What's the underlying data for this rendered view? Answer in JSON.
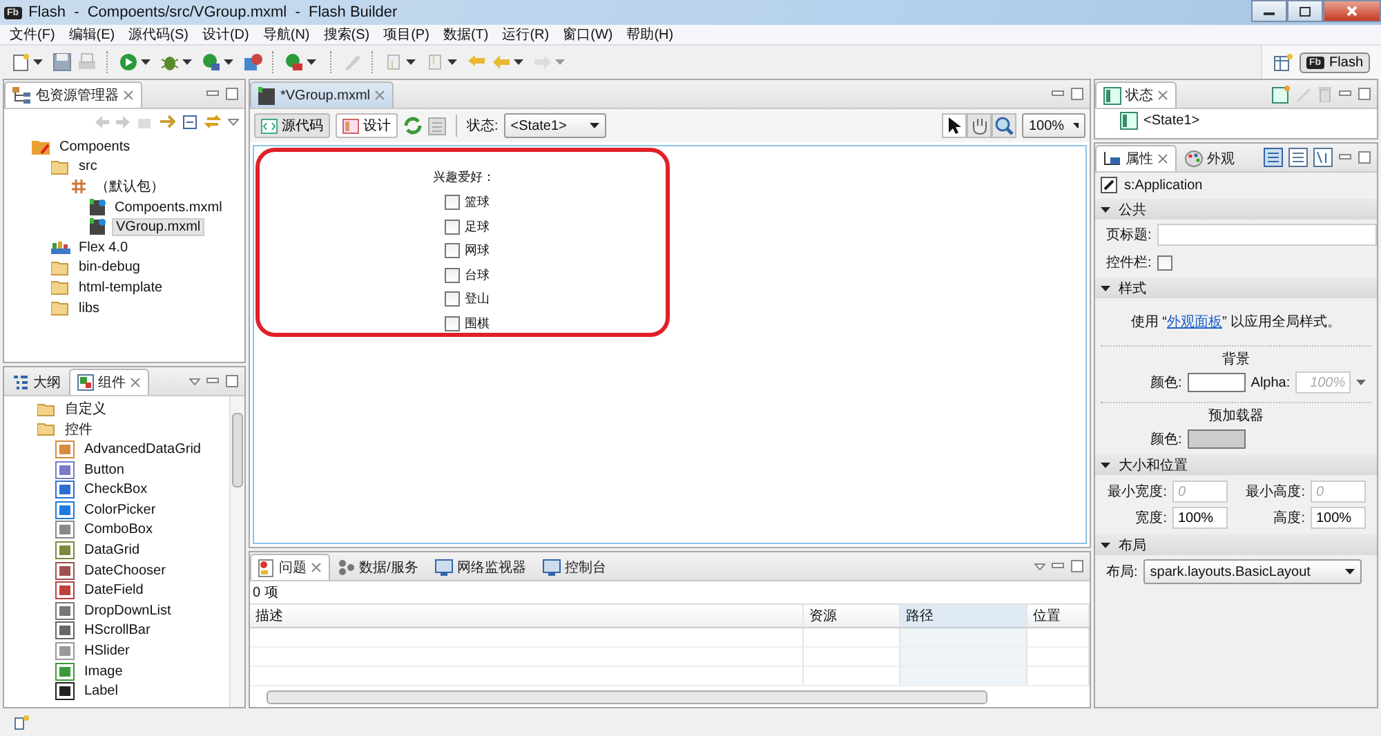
{
  "window": {
    "title": "Flash  -  Compoents/src/VGroup.mxml  -  Flash Builder",
    "badge": "Fb"
  },
  "menu": [
    "文件(F)",
    "编辑(E)",
    "源代码(S)",
    "设计(D)",
    "导航(N)",
    "搜索(S)",
    "项目(P)",
    "数据(T)",
    "运行(R)",
    "窗口(W)",
    "帮助(H)"
  ],
  "perspective": {
    "badge": "Fb",
    "label": "Flash"
  },
  "package_explorer": {
    "title": "包资源管理器",
    "tree": [
      {
        "label": "Compoents",
        "kind": "project",
        "selected": false,
        "children": [
          {
            "label": "src",
            "kind": "folder",
            "selected": false,
            "children": [
              {
                "label": "（默认包）",
                "kind": "package",
                "selected": false,
                "children": [
                  {
                    "label": "Compoents.mxml",
                    "kind": "file",
                    "selected": false
                  },
                  {
                    "label": "VGroup.mxml",
                    "kind": "file",
                    "selected": true
                  }
                ]
              }
            ]
          },
          {
            "label": "Flex 4.0",
            "kind": "library",
            "selected": false
          },
          {
            "label": "bin-debug",
            "kind": "folder",
            "selected": false
          },
          {
            "label": "html-template",
            "kind": "folder",
            "selected": false
          },
          {
            "label": "libs",
            "kind": "folder",
            "selected": false
          }
        ]
      }
    ]
  },
  "components_panel": {
    "tabs": [
      {
        "label": "大纲",
        "selected": false
      },
      {
        "label": "组件",
        "selected": true
      }
    ],
    "tree": [
      {
        "label": "自定义",
        "kind": "folder"
      },
      {
        "label": "控件",
        "kind": "folder",
        "children": [
          {
            "label": "AdvancedDataGrid"
          },
          {
            "label": "Button"
          },
          {
            "label": "CheckBox"
          },
          {
            "label": "ColorPicker"
          },
          {
            "label": "ComboBox"
          },
          {
            "label": "DataGrid"
          },
          {
            "label": "DateChooser"
          },
          {
            "label": "DateField"
          },
          {
            "label": "DropDownList"
          },
          {
            "label": "HScrollBar"
          },
          {
            "label": "HSlider"
          },
          {
            "label": "Image"
          },
          {
            "label": "Label"
          }
        ]
      }
    ]
  },
  "editor": {
    "tabs": [
      {
        "label": "*VGroup.mxml",
        "selected": true
      }
    ],
    "view_modes": [
      {
        "label": "源代码",
        "selected": false
      },
      {
        "label": "设计",
        "selected": true
      }
    ],
    "state_label": "状态:",
    "state_value": "<State1>",
    "tools": [
      {
        "kind": "pointer",
        "selected": true
      },
      {
        "kind": "hand",
        "selected": false
      },
      {
        "kind": "zoom",
        "selected": false
      }
    ],
    "zoom": "100%",
    "canvas": {
      "heading": "兴趣爱好：",
      "checkboxes": [
        {
          "label": "篮球",
          "checked": false
        },
        {
          "label": "足球",
          "checked": false
        },
        {
          "label": "网球",
          "checked": false
        },
        {
          "label": "台球",
          "checked": false
        },
        {
          "label": "登山",
          "checked": false
        },
        {
          "label": "围棋",
          "checked": false
        }
      ]
    }
  },
  "problems_panel": {
    "tabs": [
      {
        "label": "问题",
        "selected": true
      },
      {
        "label": "数据/服务",
        "selected": false
      },
      {
        "label": "网络监视器",
        "selected": false
      },
      {
        "label": "控制台",
        "selected": false
      }
    ],
    "count": "0 项",
    "columns": [
      {
        "label": "描述",
        "sorted": false
      },
      {
        "label": "资源",
        "sorted": false
      },
      {
        "label": "路径",
        "sorted": true
      },
      {
        "label": "位置",
        "sorted": false
      }
    ]
  },
  "states_panel": {
    "title": "状态",
    "states": [
      {
        "label": "<State1>"
      }
    ]
  },
  "properties": {
    "tabs": [
      {
        "label": "属性",
        "selected": true
      },
      {
        "label": "外观",
        "selected": false
      }
    ],
    "target": "s:Application",
    "common": {
      "title": "公共",
      "page_title_label": "页标题:",
      "controlbar_label": "控件栏:",
      "controlbar_checked": false
    },
    "style": {
      "title": "样式",
      "note_before": "使用 “",
      "note_link": "外观面板",
      "note_after": "” 以应用全局样式。",
      "background_title": "背景",
      "color_label": "颜色:",
      "alpha_label": "Alpha:",
      "alpha_placeholder": "100%",
      "preloader_title": "预加载器",
      "preloader_color_label": "颜色:"
    },
    "size": {
      "title": "大小和位置",
      "min_width_label": "最小宽度:",
      "min_width_placeholder": "0",
      "min_height_label": "最小高度:",
      "min_height_placeholder": "0",
      "width_label": "宽度:",
      "width_value": "100%",
      "height_label": "高度:",
      "height_value": "100%"
    },
    "layout": {
      "title": "布局",
      "label": "布局:",
      "value": "spark.layouts.BasicLayout"
    }
  }
}
